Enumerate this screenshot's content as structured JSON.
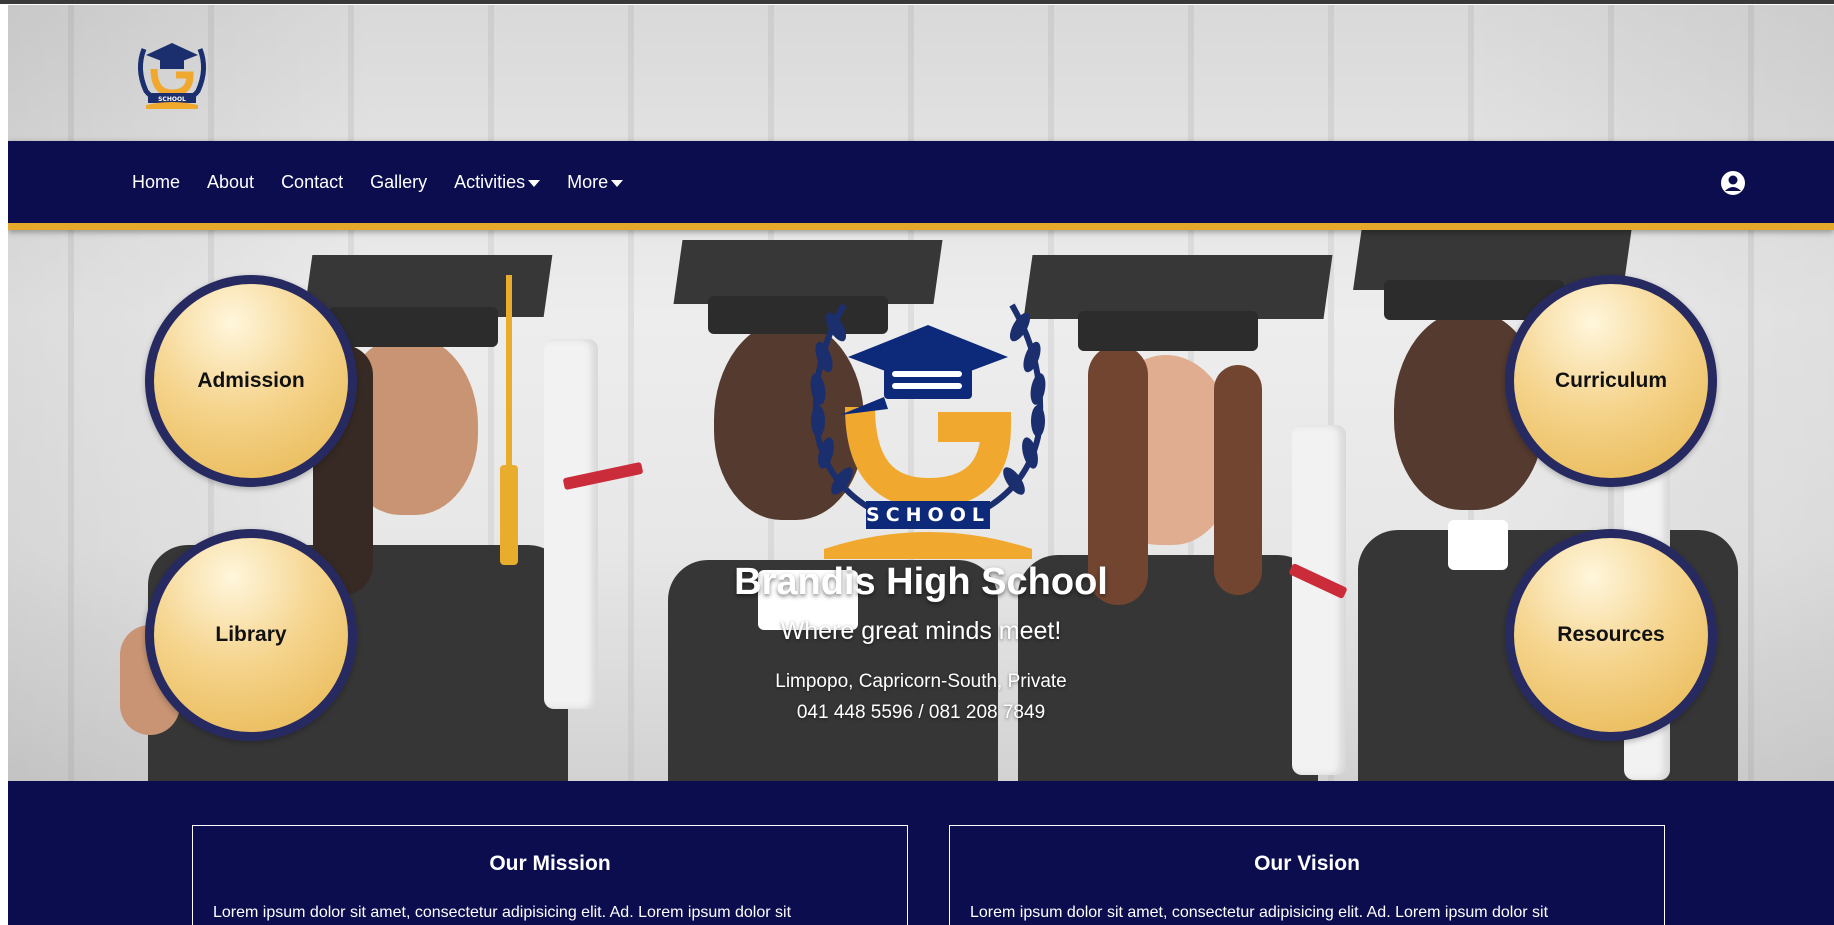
{
  "logo": {
    "icon": "school-logo-icon",
    "label": "SCHOOL"
  },
  "nav": {
    "items": [
      {
        "label": "Home",
        "dropdown": false
      },
      {
        "label": "About",
        "dropdown": false
      },
      {
        "label": "Contact",
        "dropdown": false
      },
      {
        "label": "Gallery",
        "dropdown": false
      },
      {
        "label": "Activities",
        "dropdown": true
      },
      {
        "label": "More",
        "dropdown": true
      }
    ],
    "user_icon": "user-circle-icon"
  },
  "hero": {
    "circles": {
      "admission": "Admission",
      "library": "Library",
      "curriculum": "Curriculum",
      "resources": "Resources"
    },
    "logo_label": "SCHOOL",
    "school_name": "Brandis High School",
    "tagline": "Where great minds meet!",
    "location": "Limpopo, Capricorn-South, Private",
    "phone": "041 448 5596 / 081 208 7849"
  },
  "cards": {
    "mission": {
      "title": "Our Mission",
      "text": "Lorem ipsum dolor sit amet, consectetur adipisicing elit. Ad. Lorem ipsum dolor sit"
    },
    "vision": {
      "title": "Our Vision",
      "text": "Lorem ipsum dolor sit amet, consectetur adipisicing elit. Ad. Lorem ipsum dolor sit"
    }
  },
  "colors": {
    "navy": "#0b0d4f",
    "gold": "#e4a92a",
    "circle_border": "#272a60"
  }
}
